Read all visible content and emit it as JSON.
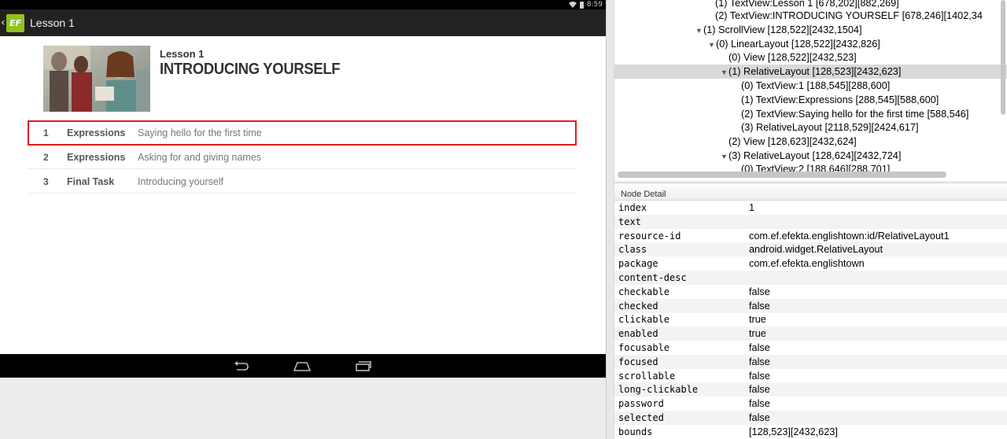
{
  "device": {
    "status": {
      "time": "8:59"
    },
    "actionbar": {
      "logo_text": "EF",
      "title": "Lesson 1"
    },
    "lesson": {
      "kicker": "Lesson 1",
      "headline": "INTRODUCING YOURSELF"
    },
    "rows": [
      {
        "num": "1",
        "type": "Expressions",
        "desc": "Saying hello for the first time",
        "selected": true
      },
      {
        "num": "2",
        "type": "Expressions",
        "desc": "Asking for and giving names",
        "selected": false
      },
      {
        "num": "3",
        "type": "Final Task",
        "desc": "Introducing yourself",
        "selected": false
      }
    ]
  },
  "tree": {
    "lines": [
      {
        "text": "(1) TextView:Lesson 1 [678,202][882,269]"
      },
      {
        "text": "(2) TextView:INTRODUCING YOURSELF [678,246][1402,34"
      },
      {
        "text": "(1) ScrollView [128,522][2432,1504]"
      },
      {
        "text": "(0) LinearLayout [128,522][2432,826]"
      },
      {
        "text": "(0) View [128,522][2432,523]"
      },
      {
        "text": "(1) RelativeLayout [128,523][2432,623]"
      },
      {
        "text": "(0) TextView:1 [188,545][288,600]"
      },
      {
        "text": "(1) TextView:Expressions [288,545][588,600]"
      },
      {
        "text": "(2) TextView:Saying hello for the first time [588,546]"
      },
      {
        "text": "(3) RelativeLayout [2118,529][2424,617]"
      },
      {
        "text": "(2) View [128,623][2432,624]"
      },
      {
        "text": "(3) RelativeLayout [128,624][2432,724]"
      },
      {
        "text": "(0) TextView:2 [188,646][288,701]"
      }
    ]
  },
  "detail": {
    "header": "Node Detail",
    "props": [
      {
        "k": "index",
        "v": "1"
      },
      {
        "k": "text",
        "v": ""
      },
      {
        "k": "resource-id",
        "v": "com.ef.efekta.englishtown:id/RelativeLayout1"
      },
      {
        "k": "class",
        "v": "android.widget.RelativeLayout"
      },
      {
        "k": "package",
        "v": "com.ef.efekta.englishtown"
      },
      {
        "k": "content-desc",
        "v": ""
      },
      {
        "k": "checkable",
        "v": "false"
      },
      {
        "k": "checked",
        "v": "false"
      },
      {
        "k": "clickable",
        "v": "true"
      },
      {
        "k": "enabled",
        "v": "true"
      },
      {
        "k": "focusable",
        "v": "false"
      },
      {
        "k": "focused",
        "v": "false"
      },
      {
        "k": "scrollable",
        "v": "false"
      },
      {
        "k": "long-clickable",
        "v": "false"
      },
      {
        "k": "password",
        "v": "false"
      },
      {
        "k": "selected",
        "v": "false"
      },
      {
        "k": "bounds",
        "v": "[128,523][2432,623]"
      }
    ]
  }
}
